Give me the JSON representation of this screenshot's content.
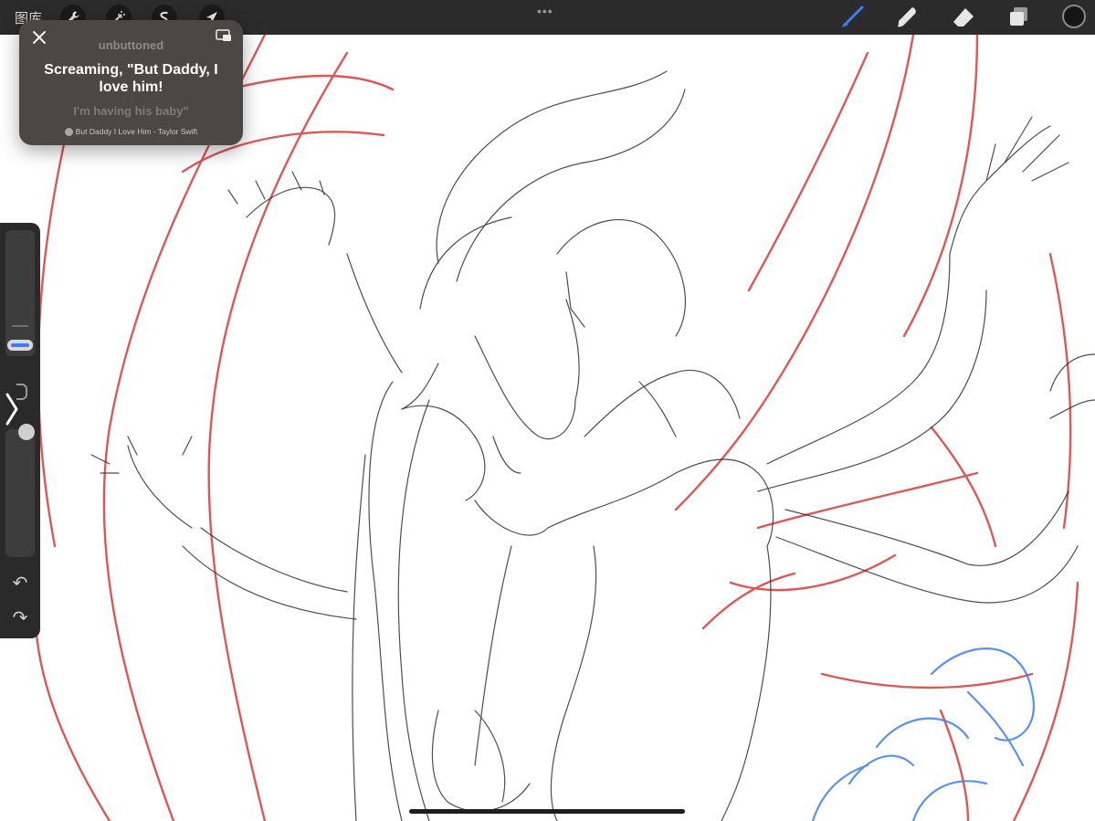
{
  "toolbar": {
    "gallery_label": "图库",
    "left_tools": [
      "wrench-icon",
      "magic-wand-icon",
      "selection-icon",
      "transform-arrow-icon"
    ],
    "more_indicator": "•••",
    "right_tools": [
      "brush-icon",
      "smudge-icon",
      "eraser-icon",
      "layers-icon"
    ],
    "active_tool": "brush-icon",
    "active_color": "#161616",
    "accent": "#3b7cf5"
  },
  "lyrics": {
    "previous_line": "unbuttoned",
    "current_line": "Screaming, \"But Daddy, I love him!",
    "next_line": "I'm having his baby\"",
    "song": "But Daddy I Love Him - Taylor Swift"
  },
  "sidebar": {
    "undo": "↶",
    "redo": "↷"
  },
  "colors": {
    "sketch_red": "#d93a3a",
    "sketch_blue": "#3d7fe6",
    "pencil": "#2f2f2f"
  }
}
